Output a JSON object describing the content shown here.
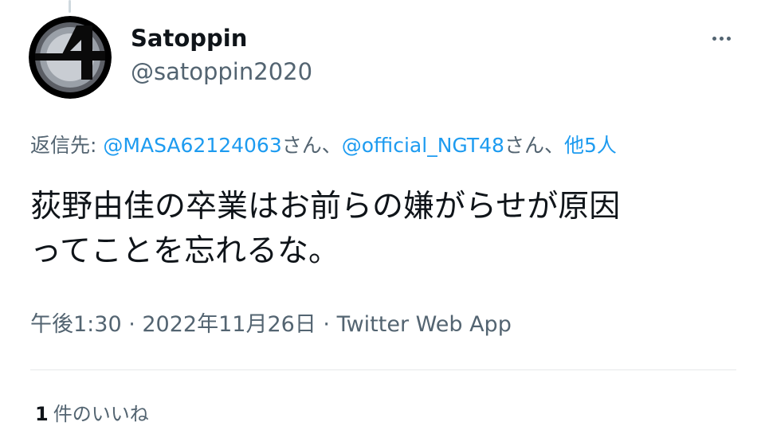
{
  "tweet": {
    "author": {
      "display_name": "Satoppin",
      "handle": "@satoppin2020",
      "avatar_icon": "fantastic-four-logo-icon"
    },
    "more_icon": "more-dots-icon",
    "reply_to": {
      "prefix": "返信先:",
      "mention_1": "@MASA62124063",
      "honorific_1": "さん、",
      "mention_2": "@official_NGT48",
      "honorific_2": "さん、",
      "others": "他5人"
    },
    "text_lines": [
      "荻野由佳の卒業はお前らの嫌がらせが原因",
      "ってことを忘れるな。"
    ],
    "timestamp": "午後1:30 · 2022年11月26日",
    "separator": " · ",
    "source": "Twitter Web App",
    "likes": {
      "count": "1",
      "label": "件のいいね"
    }
  },
  "colors": {
    "text_primary": "#0f1419",
    "text_secondary": "#536471",
    "link": "#1d9bf0",
    "divider": "#e7e9ea"
  }
}
